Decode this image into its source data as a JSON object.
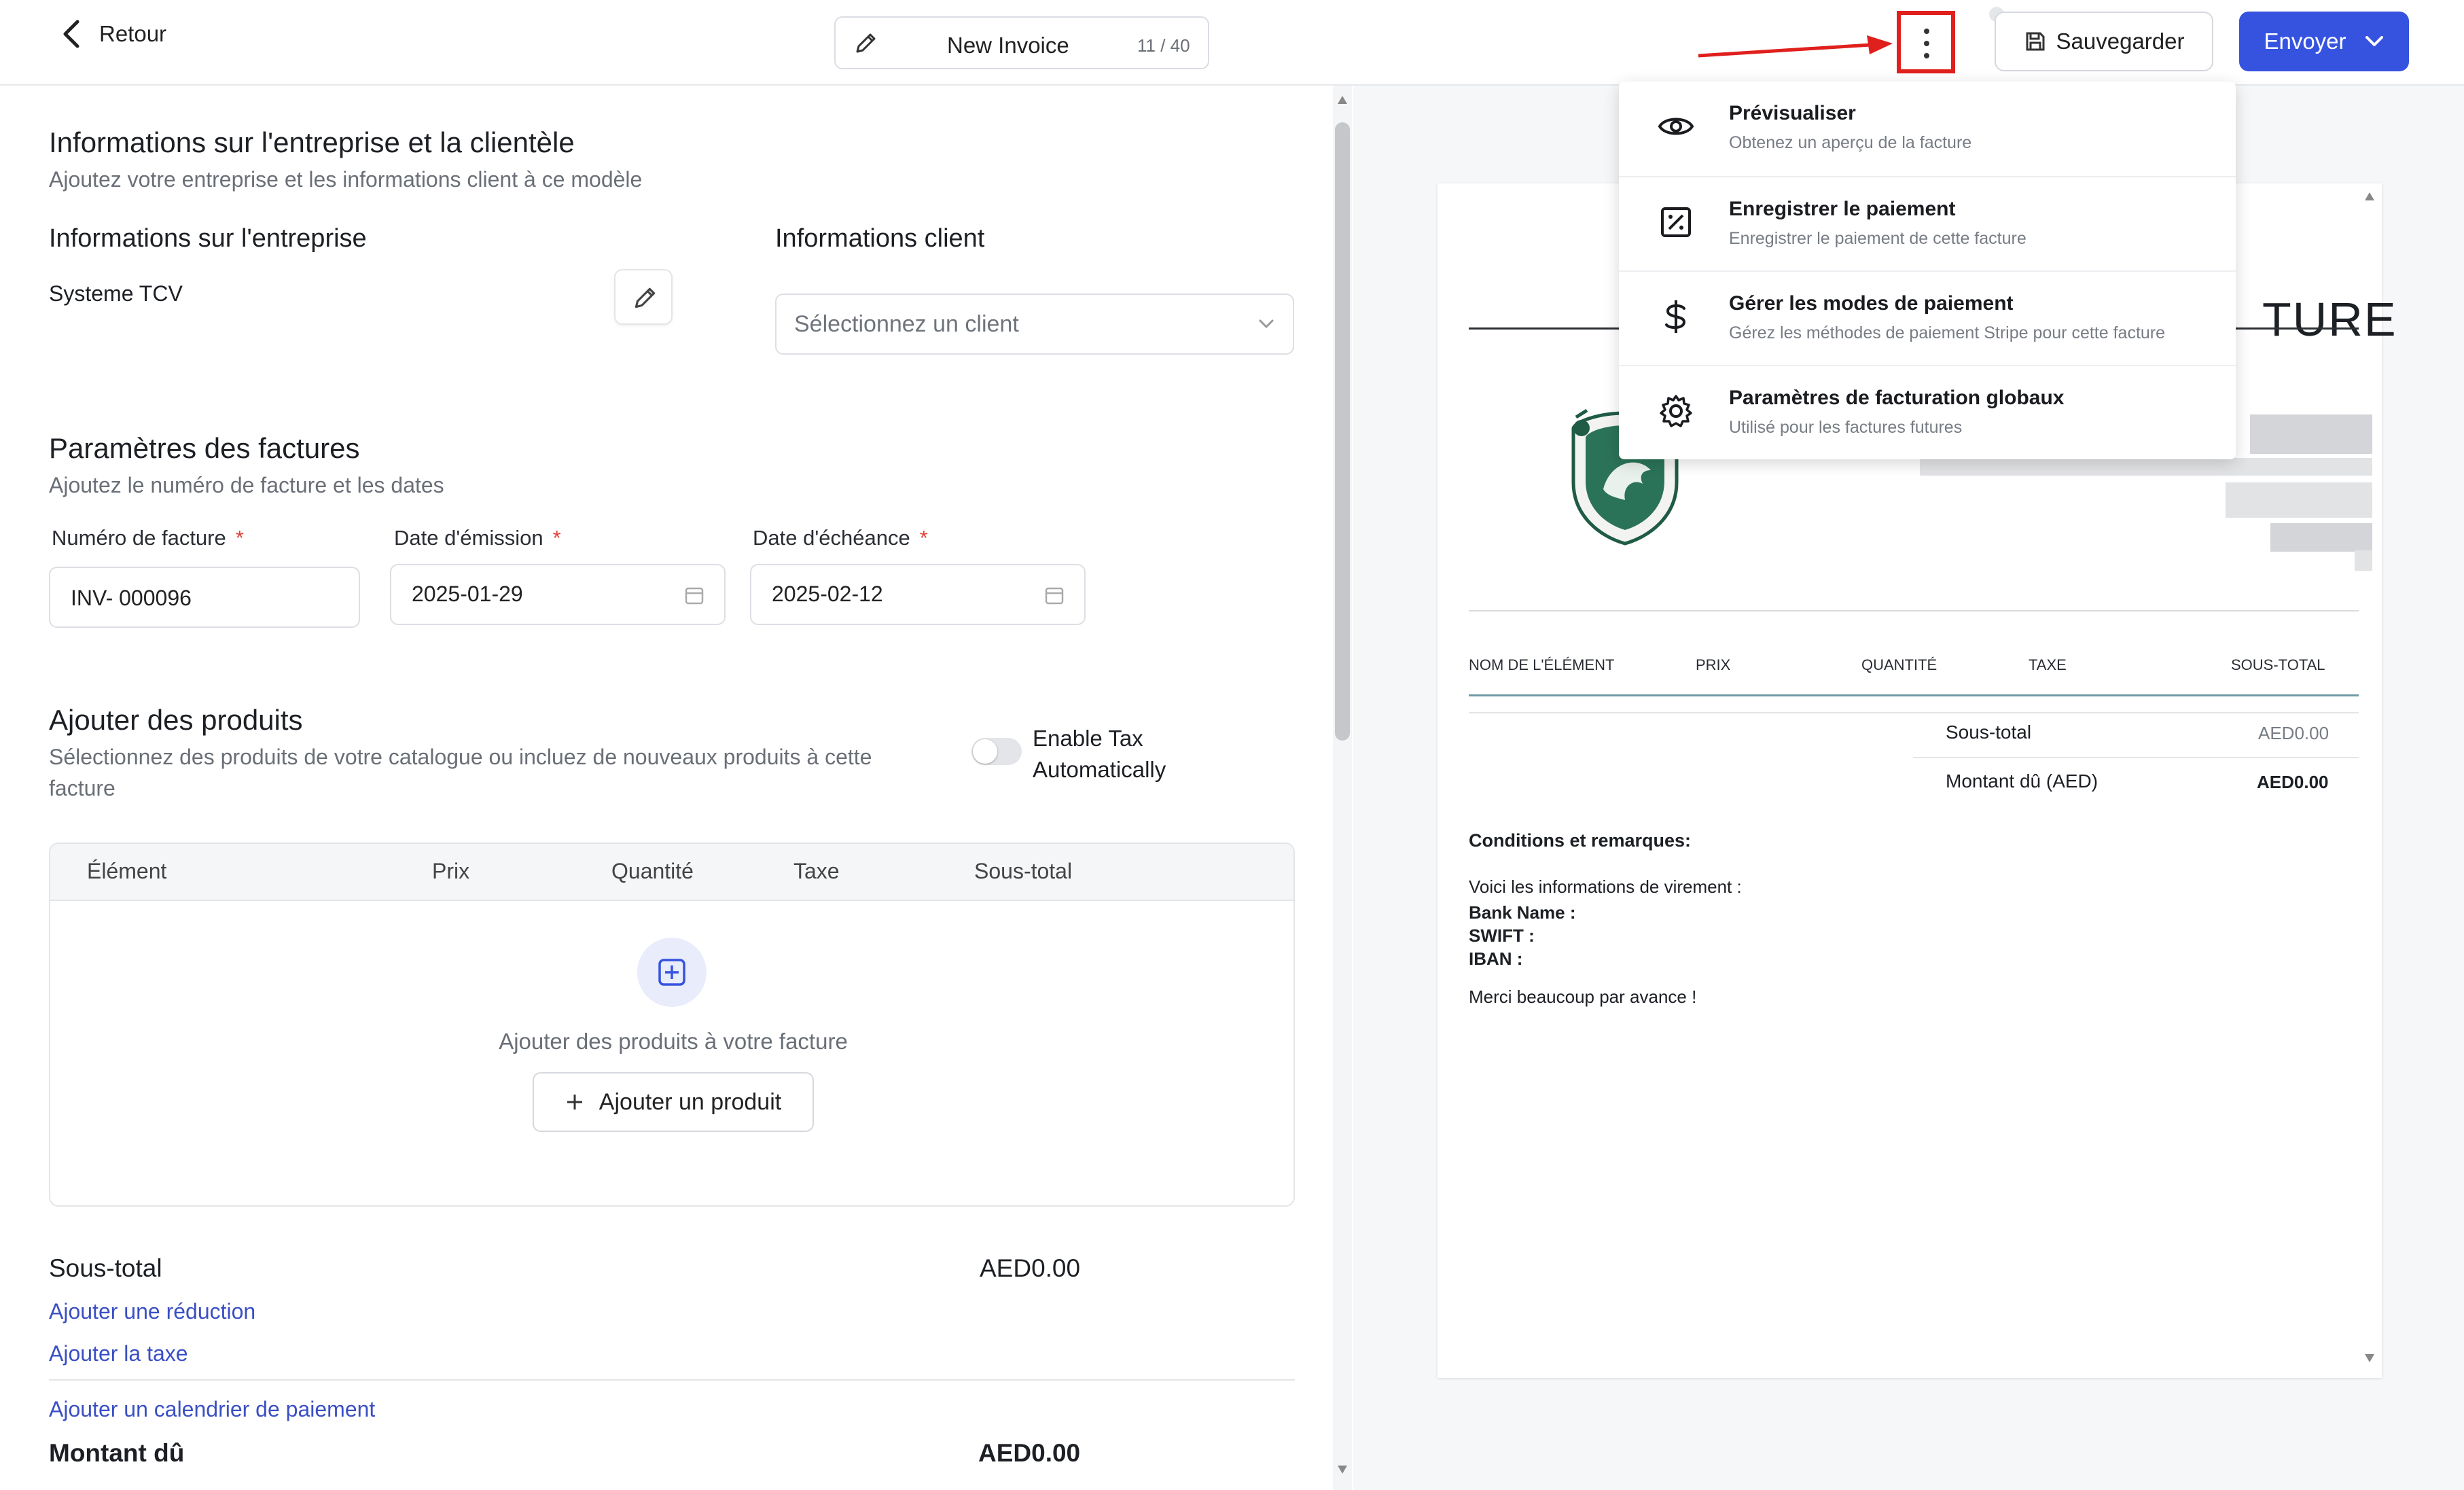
{
  "topbar": {
    "back_label": "Retour",
    "doc_title": "New Invoice",
    "char_count": "11 / 40",
    "save_label": "Sauvegarder",
    "send_label": "Envoyer"
  },
  "menu": {
    "items": [
      {
        "title": "Prévisualiser",
        "subtitle": "Obtenez un aperçu de la facture",
        "icon": "eye-icon"
      },
      {
        "title": "Enregistrer le paiement",
        "subtitle": "Enregistrer le paiement de cette facture",
        "icon": "payment-record-icon"
      },
      {
        "title": "Gérer les modes de paiement",
        "subtitle": "Gérez les méthodes de paiement Stripe pour cette facture",
        "icon": "dollar-icon"
      },
      {
        "title": "Paramètres de facturation globaux",
        "subtitle": "Utilisé pour les factures futures",
        "icon": "gear-icon"
      }
    ]
  },
  "company_section": {
    "title": "Informations sur l'entreprise et la clientèle",
    "subtitle": "Ajoutez votre entreprise et les informations client à ce modèle",
    "company_heading": "Informations sur l'entreprise",
    "company_name": "Systeme TCV",
    "client_heading": "Informations client",
    "client_placeholder": "Sélectionnez un client"
  },
  "invoice_params": {
    "title": "Paramètres des factures",
    "subtitle": "Ajoutez le numéro de facture et les dates",
    "number_label": "Numéro de facture",
    "number_value": "INV- 000096",
    "issue_label": "Date d'émission",
    "issue_value": "2025-01-29",
    "due_label": "Date d'échéance",
    "due_value": "2025-02-12",
    "required_mark": "*"
  },
  "products": {
    "title": "Ajouter des produits",
    "subtitle_line1": "Sélectionnez des produits de votre catalogue ou incluez de nouveaux produits à cette",
    "subtitle_line2": "facture",
    "tax_toggle_line1": "Enable Tax",
    "tax_toggle_line2": "Automatically",
    "columns": [
      "Élément",
      "Prix",
      "Quantité",
      "Taxe",
      "Sous-total"
    ],
    "empty_text": "Ajouter des produits à votre facture",
    "add_button": "Ajouter un produit"
  },
  "totals": {
    "subtotal_label": "Sous-total",
    "subtotal_value": "AED0.00",
    "add_discount": "Ajouter une réduction",
    "add_tax": "Ajouter la taxe",
    "add_schedule": "Ajouter un calendrier de paiement",
    "amount_due_label": "Montant dû",
    "amount_due_value": "AED0.00"
  },
  "preview": {
    "heading_fragment": "TURE",
    "columns": [
      "NOM DE L'ÉLÉMENT",
      "PRIX",
      "QUANTITÉ",
      "TAXE",
      "SOUS-TOTAL"
    ],
    "subtotal_label": "Sous-total",
    "subtotal_value": "AED0.00",
    "amount_due_label": "Montant dû (AED)",
    "amount_due_value": "AED0.00",
    "terms_heading": "Conditions et remarques:",
    "terms_intro": "Voici les informations de virement :",
    "bank_name": "Bank Name :",
    "swift": "SWIFT :",
    "iban": "IBAN :",
    "thanks": "Merci beaucoup par avance !"
  },
  "colors": {
    "accent": "#3653e0",
    "highlight": "#e0201d",
    "link": "#3a4fc4",
    "logo_green": "#1f5b45"
  }
}
